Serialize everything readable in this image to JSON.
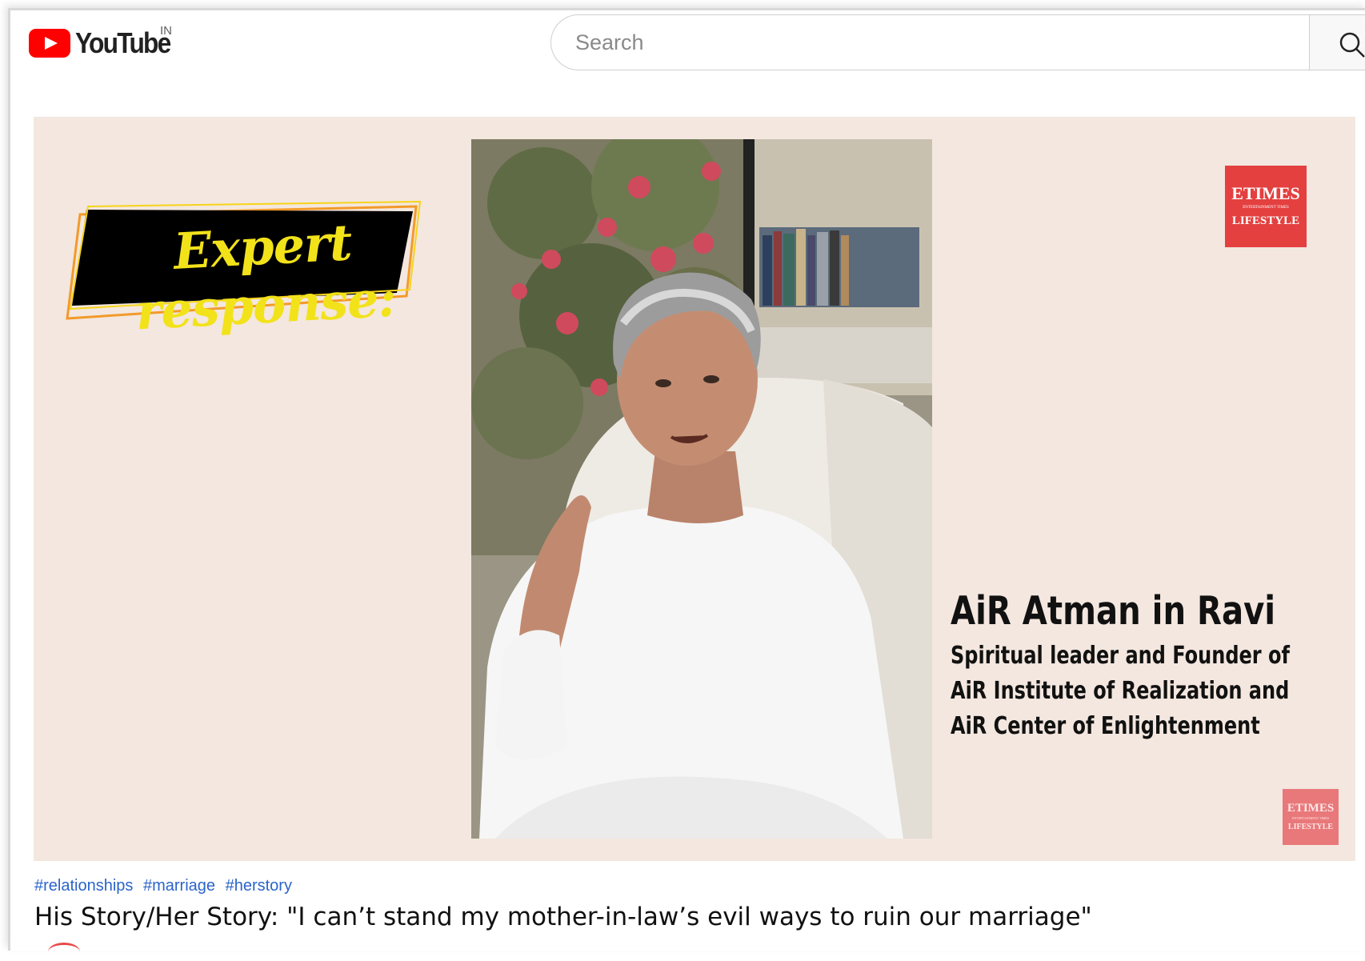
{
  "masthead": {
    "logo_text": "YouTube",
    "country_code": "IN",
    "search_placeholder": "Search"
  },
  "video": {
    "overlay_heading": "Expert response:",
    "speaker_name": "AiR Atman in Ravi",
    "speaker_role_lines": [
      "Spiritual leader and Founder of",
      "AiR Institute of Realization and",
      "AiR Center of Enlightenment"
    ],
    "brand_badge": {
      "main": "ETIMES",
      "tagline": "ENTERTAINMENT TIMES",
      "sub": "LIFESTYLE"
    }
  },
  "info": {
    "hashtags": [
      "#relationships",
      "#marriage",
      "#herstory"
    ],
    "title": "His Story/Her Story: \"I can’t stand my mother-in-law’s evil ways to ruin our marriage\""
  },
  "colors": {
    "youtube_red": "#ff0000",
    "video_bg": "#f3e7df",
    "badge_red": "#e44040",
    "hashtag_blue": "#2b64c9",
    "banner_yellow": "#f2e21a"
  }
}
